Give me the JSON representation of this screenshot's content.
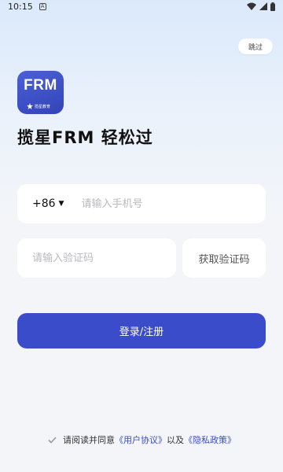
{
  "status_bar": {
    "time": "10:15",
    "notification_icon": "A"
  },
  "header": {
    "skip_label": "跳过"
  },
  "logo": {
    "text": "FRM",
    "subtext": "揽星教育"
  },
  "headline": "揽星FRM 轻松过",
  "phone": {
    "country_code": "+86",
    "placeholder": "请输入手机号"
  },
  "verification": {
    "placeholder": "请输入验证码",
    "get_code_label": "获取验证码"
  },
  "login_button_label": "登录/注册",
  "agreement": {
    "prefix": "请阅读并同意",
    "user_agreement": "《用户协议》",
    "connector": "以及",
    "privacy_policy": "《隐私政策》"
  },
  "colors": {
    "primary": "#3a4cc9",
    "background_top": "#dbe9fb",
    "background_bottom": "#f4f5f8"
  }
}
